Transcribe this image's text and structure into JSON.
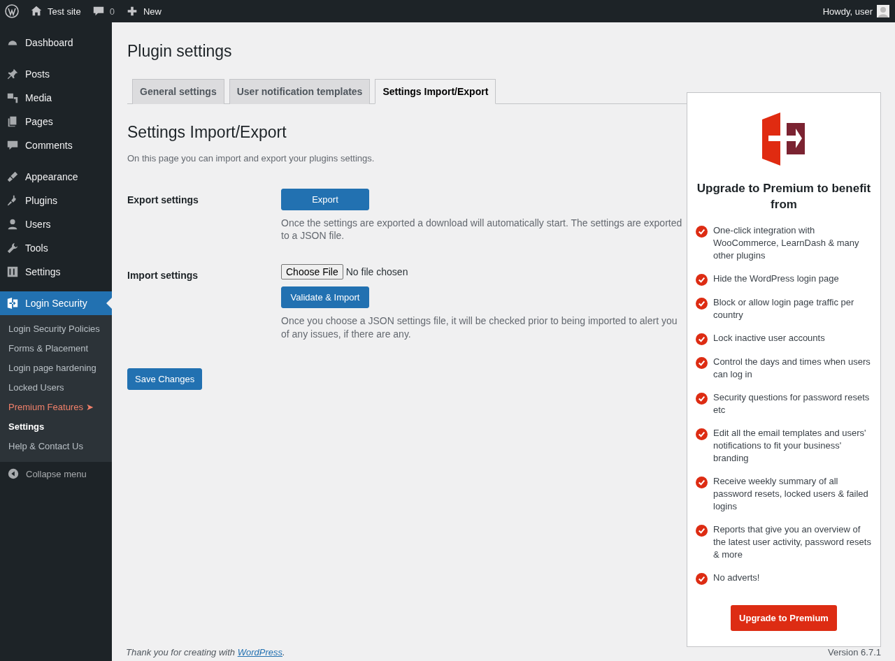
{
  "admin_bar": {
    "site": "Test site",
    "comments": "0",
    "new": "New",
    "howdy": "Howdy, user"
  },
  "sidebar": {
    "groups": [
      [
        {
          "label": "Dashboard",
          "selected": false
        }
      ],
      [
        {
          "label": "Posts",
          "selected": false
        },
        {
          "label": "Media",
          "selected": false
        },
        {
          "label": "Pages",
          "selected": false
        },
        {
          "label": "Comments",
          "selected": false
        }
      ],
      [
        {
          "label": "Appearance",
          "selected": false
        },
        {
          "label": "Plugins",
          "selected": false
        },
        {
          "label": "Users",
          "selected": false
        },
        {
          "label": "Tools",
          "selected": false
        },
        {
          "label": "Settings",
          "selected": false
        }
      ],
      [
        {
          "label": "Login Security",
          "selected": true
        }
      ]
    ],
    "submenu": [
      {
        "label": "Login Security Policies",
        "kind": "link",
        "selected": false
      },
      {
        "label": "Forms & Placement",
        "kind": "link",
        "selected": false
      },
      {
        "label": "Login page hardening",
        "kind": "link",
        "selected": false
      },
      {
        "label": "Locked Users",
        "kind": "link",
        "selected": false
      },
      {
        "label": "Premium Features ➤",
        "kind": "premium",
        "selected": false
      },
      {
        "label": "Settings",
        "kind": "link",
        "selected": true
      },
      {
        "label": "Help & Contact Us",
        "kind": "link",
        "selected": false
      }
    ],
    "collapse": "Collapse menu"
  },
  "page_title": "Plugin settings",
  "tabs": [
    {
      "label": "General settings",
      "selected": false
    },
    {
      "label": "User notification templates",
      "selected": false
    },
    {
      "label": "Settings Import/Export",
      "selected": true
    }
  ],
  "section": {
    "title": "Settings Import/Export",
    "intro": "On this page you can import and export your plugins settings."
  },
  "export": {
    "label": "Export settings",
    "button": "Export",
    "help": "Once the settings are exported a download will automatically start. The settings are exported to a JSON file."
  },
  "import": {
    "label": "Import settings",
    "file_button": "Choose File",
    "file_status": "No file chosen",
    "button": "Validate & Import",
    "help": "Once you choose a JSON settings file, it will be checked prior to being imported to alert you of any issues, if there are any."
  },
  "save_button": "Save Changes",
  "premium_card": {
    "title": "Upgrade to Premium to benefit from",
    "features": [
      "One-click integration with WooCommerce, LearnDash & many other plugins",
      "Hide the WordPress login page",
      "Block or allow login page traffic per country",
      "Lock inactive user accounts",
      "Control the days and times when users can log in",
      "Security questions for password resets etc",
      "Edit all the email templates and users' notifications to fit your business' branding",
      "Receive weekly summary of all password resets, locked users & failed logins",
      "Reports that give you an overview of the latest user activity, password resets & more",
      "No adverts!"
    ],
    "button": "Upgrade to Premium"
  },
  "footer": {
    "thanks": "Thank you for creating with",
    "link": "WordPress",
    "period": ".",
    "version": "Version 6.7.1"
  }
}
